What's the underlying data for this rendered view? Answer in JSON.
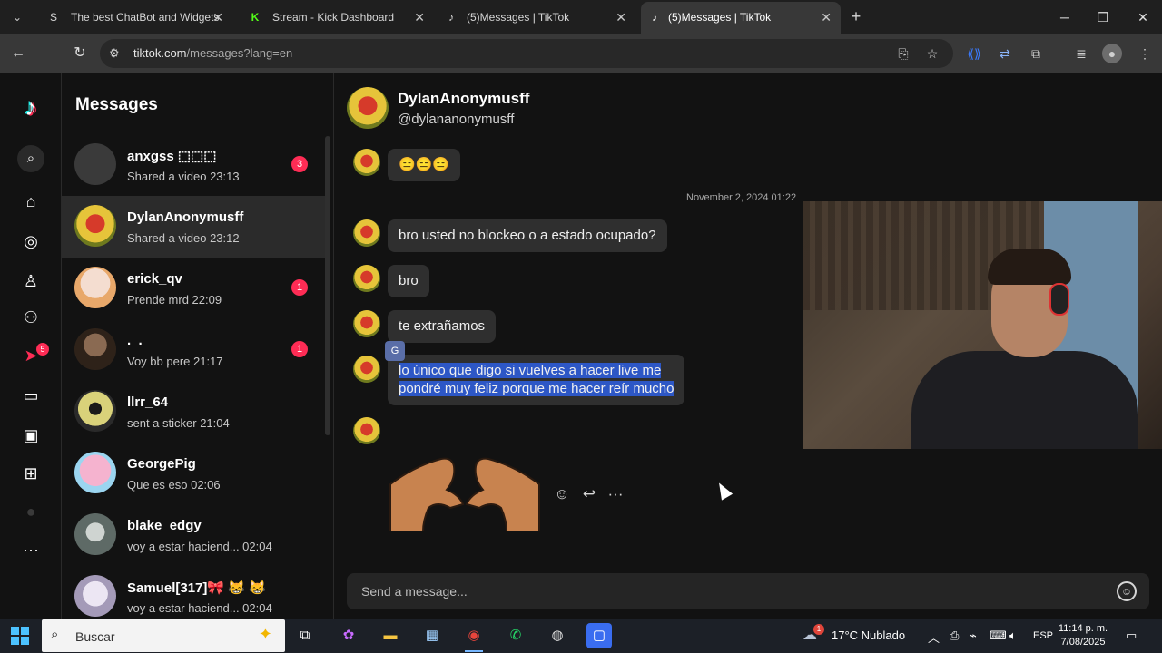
{
  "browser": {
    "tabs": [
      {
        "title": "The best ChatBot and Widgets",
        "icon": "S"
      },
      {
        "title": "Stream - Kick Dashboard",
        "icon": "K"
      },
      {
        "title": "(5)Messages | TikTok",
        "icon": "♪"
      },
      {
        "title": "(5)Messages | TikTok",
        "icon": "♪"
      }
    ],
    "url_host": "tiktok.com",
    "url_path": "/messages?lang=en"
  },
  "rail": {
    "notification_count": "5"
  },
  "conversations": {
    "title": "Messages",
    "items": [
      {
        "name": "anxgss ⬚⬚⬚",
        "preview": "Shared a video 23:13",
        "unread": "3",
        "avatar_color": "#3a3a3a"
      },
      {
        "name": "DylanAnonymusff",
        "preview": "Shared a video 23:12",
        "unread": "",
        "avatar_color": "#b89a2a"
      },
      {
        "name": "erick_qv",
        "preview": "Prende mrd 22:09",
        "unread": "1",
        "avatar_color": "#e9c9b8"
      },
      {
        "name": "._.",
        "preview": "Voy bb pere 21:17",
        "unread": "1",
        "avatar_color": "#4a3a2e"
      },
      {
        "name": "llrr_64",
        "preview": "sent a sticker 21:04",
        "unread": "",
        "avatar_color": "#c9c9a0"
      },
      {
        "name": "GeorgePig",
        "preview": "Que es eso 02:06",
        "unread": "",
        "avatar_color": "#f2a6c4"
      },
      {
        "name": "blake_edgy",
        "preview": "voy a estar haciend... 02:04",
        "unread": "",
        "avatar_color": "#7f8a8a"
      },
      {
        "name": "Samuel[317]🎀 😸 😸",
        "preview": "voy a estar haciend... 02:04",
        "unread": "",
        "avatar_color": "#d8d0e6"
      }
    ]
  },
  "chat": {
    "display_name": "DylanAnonymusff",
    "handle": "@dylananonymusff",
    "timestamp": "November 2, 2024 01:22",
    "messages": [
      {
        "text": "😑😑😑"
      },
      {
        "text": "bro usted no blockeo o a estado ocupado?"
      },
      {
        "text": "bro"
      },
      {
        "text": "te extrañamos"
      },
      {
        "line1": "lo único que digo si vuelves a hacer live me",
        "line2": "pondré muy feliz porque me hacer reír mucho"
      }
    ],
    "composer_placeholder": "Send a message..."
  },
  "taskbar": {
    "search_label": "Buscar",
    "weather_badge": "1",
    "weather": "17°C  Nublado",
    "language": "ESP",
    "time": "11:14 p. m.",
    "date": "7/08/2025"
  }
}
